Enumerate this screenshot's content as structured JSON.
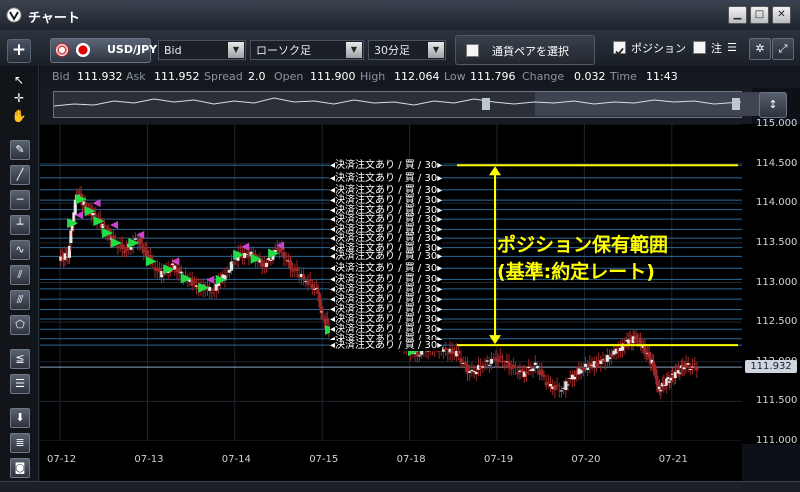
{
  "window": {
    "title": "チャート",
    "buttons": {
      "minimize": "▁",
      "maximize": "□",
      "close": "✕"
    }
  },
  "toolbar": {
    "currency_pair": "USD/JPY",
    "price_type": "Bid",
    "chart_type": "ローソク足",
    "timeframe": "30分足",
    "pair_select_label": "通貨ペアを選択",
    "position_label": "ポジション",
    "position_checked": true,
    "order_label": "注",
    "order_checked": false
  },
  "quote": {
    "bid_label": "Bid",
    "bid": "111.932",
    "ask_label": "Ask",
    "ask": "111.952",
    "spread_label": "Spread",
    "spread": "2.0",
    "open_label": "Open",
    "open": "111.900",
    "high_label": "High",
    "high": "112.064",
    "low_label": "Low",
    "low": "111.796",
    "change_label": "Change",
    "change": "0.032",
    "time_label": "Time",
    "time": "11:43"
  },
  "annotation": {
    "line1": "ポジション保有範囲",
    "line2": "(基準:約定レート)"
  },
  "colors": {
    "annotation": "#ffff00",
    "buy_marker": "#22dd44",
    "sell_marker": "#cc44cc",
    "candle": "#a02828",
    "order_line": "#2a6a96",
    "current_price_line": "#8aa0c0"
  },
  "chart_data": {
    "type": "candlestick",
    "ylim": [
      111.0,
      115.0
    ],
    "y_ticks": [
      "115.000",
      "114.500",
      "114.000",
      "113.500",
      "113.000",
      "112.500",
      "112.000",
      "111.500",
      "111.000"
    ],
    "x_ticks": [
      "07-12",
      "07-13",
      "07-14",
      "07-15",
      "07-18",
      "07-19",
      "07-20",
      "07-21"
    ],
    "current_price": "111.932",
    "order_label": "決済注文あり / 買 / 30",
    "order_levels": [
      114.48,
      114.32,
      114.17,
      114.04,
      113.92,
      113.8,
      113.67,
      113.56,
      113.44,
      113.33,
      113.18,
      113.04,
      112.92,
      112.79,
      112.66,
      112.54,
      112.41,
      112.29,
      112.21
    ],
    "position_range": [
      112.21,
      114.48
    ],
    "close_series": [
      {
        "x": 0,
        "y": 113.3
      },
      {
        "x": 0.1,
        "y": 113.35
      },
      {
        "x": 0.2,
        "y": 114.15
      },
      {
        "x": 0.3,
        "y": 113.95
      },
      {
        "x": 0.4,
        "y": 113.85
      },
      {
        "x": 0.5,
        "y": 113.7
      },
      {
        "x": 0.6,
        "y": 113.55
      },
      {
        "x": 0.75,
        "y": 113.4
      },
      {
        "x": 0.9,
        "y": 113.55
      },
      {
        "x": 1.0,
        "y": 113.35
      },
      {
        "x": 1.15,
        "y": 113.1
      },
      {
        "x": 1.3,
        "y": 113.2
      },
      {
        "x": 1.45,
        "y": 113.05
      },
      {
        "x": 1.6,
        "y": 112.95
      },
      {
        "x": 1.75,
        "y": 112.9
      },
      {
        "x": 1.9,
        "y": 113.1
      },
      {
        "x": 2.05,
        "y": 113.35
      },
      {
        "x": 2.2,
        "y": 113.35
      },
      {
        "x": 2.35,
        "y": 113.2
      },
      {
        "x": 2.5,
        "y": 113.45
      },
      {
        "x": 2.65,
        "y": 113.2
      },
      {
        "x": 2.8,
        "y": 113.05
      },
      {
        "x": 2.95,
        "y": 112.9
      },
      {
        "x": 3.0,
        "y": 112.6
      },
      {
        "x": 3.1,
        "y": 112.4
      },
      {
        "x": 3.2,
        "y": 112.55
      },
      {
        "x": 3.35,
        "y": 112.4
      },
      {
        "x": 3.5,
        "y": 112.35
      },
      {
        "x": 3.65,
        "y": 112.45
      },
      {
        "x": 3.8,
        "y": 112.3
      },
      {
        "x": 3.95,
        "y": 112.2
      },
      {
        "x": 4.1,
        "y": 112.1
      },
      {
        "x": 4.25,
        "y": 112.2
      },
      {
        "x": 4.4,
        "y": 112.15
      },
      {
        "x": 4.55,
        "y": 112.1
      },
      {
        "x": 4.7,
        "y": 111.85
      },
      {
        "x": 4.85,
        "y": 111.95
      },
      {
        "x": 5.0,
        "y": 112.05
      },
      {
        "x": 5.15,
        "y": 111.95
      },
      {
        "x": 5.3,
        "y": 111.85
      },
      {
        "x": 5.45,
        "y": 111.95
      },
      {
        "x": 5.6,
        "y": 111.7
      },
      {
        "x": 5.75,
        "y": 111.65
      },
      {
        "x": 5.9,
        "y": 111.85
      },
      {
        "x": 6.05,
        "y": 111.95
      },
      {
        "x": 6.2,
        "y": 112.0
      },
      {
        "x": 6.35,
        "y": 112.1
      },
      {
        "x": 6.5,
        "y": 112.25
      },
      {
        "x": 6.6,
        "y": 112.3
      },
      {
        "x": 6.7,
        "y": 112.15
      },
      {
        "x": 6.8,
        "y": 111.95
      },
      {
        "x": 6.85,
        "y": 111.65
      },
      {
        "x": 6.95,
        "y": 111.75
      },
      {
        "x": 7.05,
        "y": 111.85
      },
      {
        "x": 7.15,
        "y": 111.95
      },
      {
        "x": 7.3,
        "y": 111.93
      }
    ]
  }
}
